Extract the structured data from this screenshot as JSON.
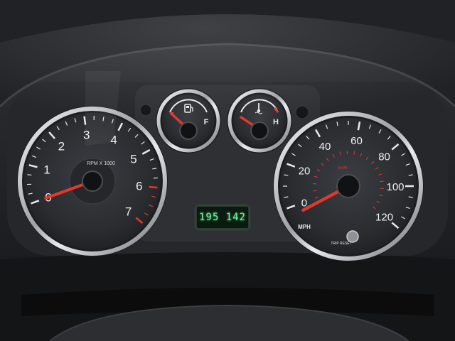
{
  "tachometer": {
    "unit_label": "RPM X 1000",
    "ticks": [
      "0",
      "1",
      "2",
      "3",
      "4",
      "5",
      "6",
      "7"
    ]
  },
  "fuel_gauge": {
    "full_label": "F",
    "icon": "fuel-pump-icon"
  },
  "temp_gauge": {
    "hot_label": "H",
    "icon": "coolant-thermometer-icon"
  },
  "speedometer": {
    "unit_label": "MPH",
    "mph_ticks": [
      "0",
      "20",
      "40",
      "60",
      "80",
      "100",
      "120"
    ],
    "inner_unit_label": "km/h",
    "reset_label": "TRIP RESET"
  },
  "odometer": {
    "reading": "195 142"
  },
  "colors": {
    "needle": "#e2382c",
    "odometer_text": "#6df59a",
    "chrome": "#c9ccd0"
  }
}
